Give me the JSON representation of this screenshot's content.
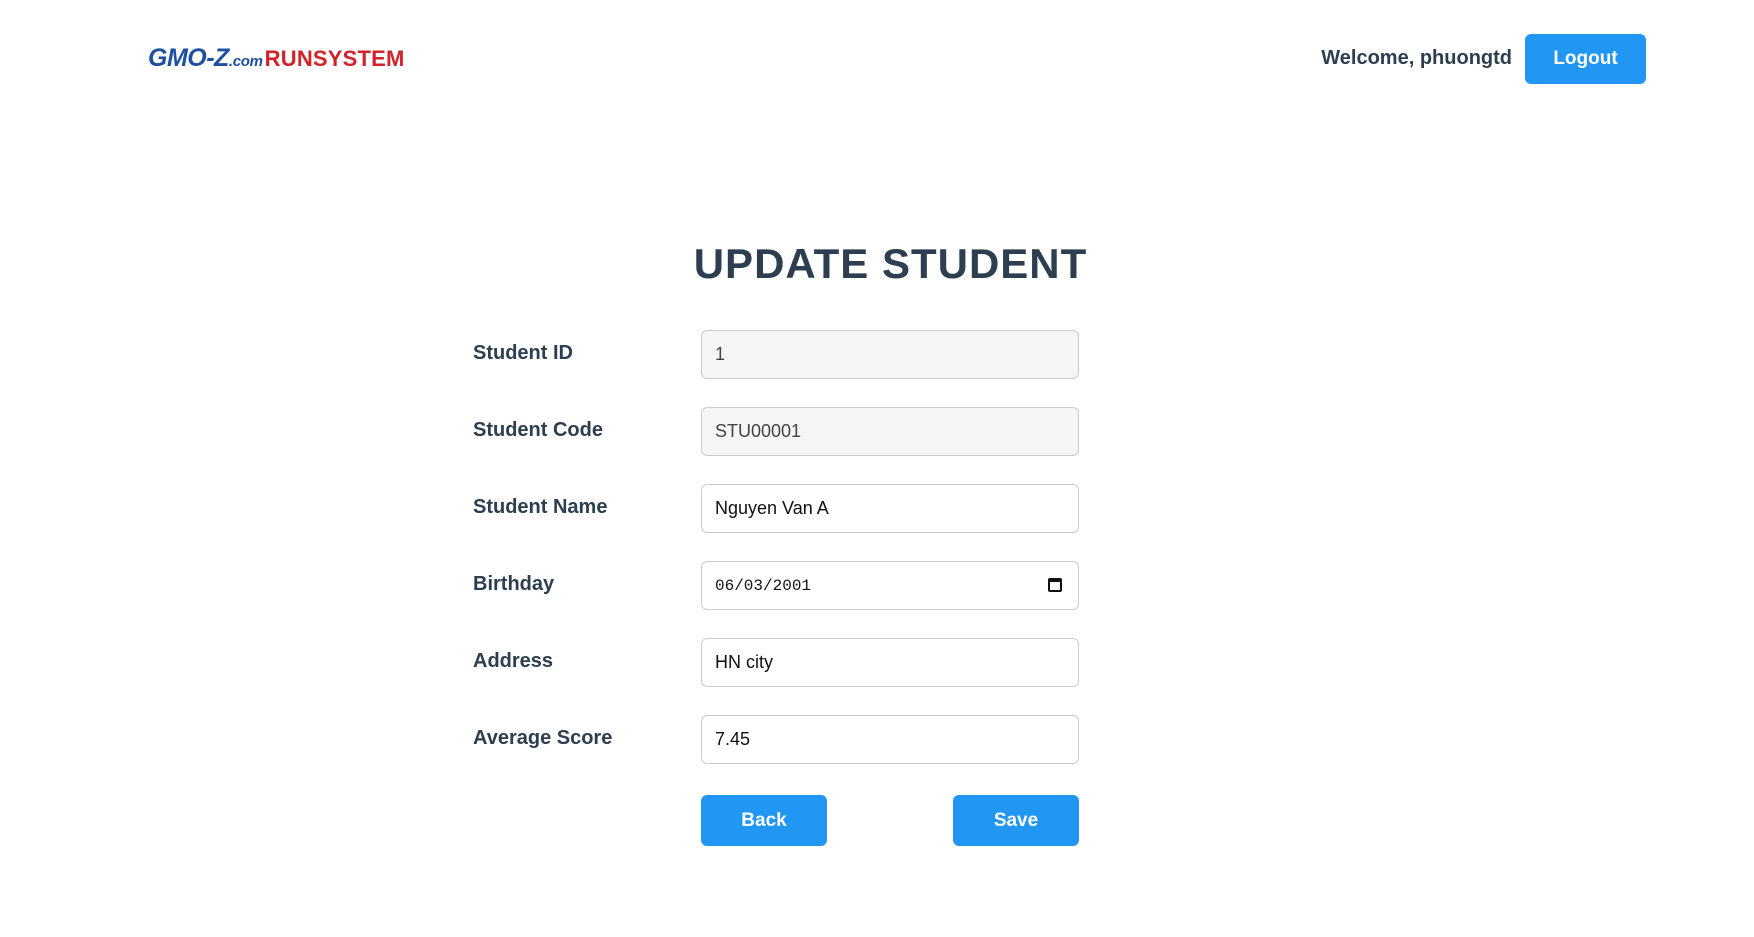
{
  "header": {
    "logo": {
      "part1": "GMO-Z",
      "part2": ".com",
      "part3": "RUNSYSTEM"
    },
    "welcome_text": "Welcome, phuongtd",
    "logout_label": "Logout"
  },
  "form": {
    "title": "UPDATE STUDENT",
    "fields": [
      {
        "label": "Student ID",
        "value": "1",
        "readonly": true
      },
      {
        "label": "Student Code",
        "value": "STU00001",
        "readonly": true
      },
      {
        "label": "Student Name",
        "value": "Nguyen Van A",
        "readonly": false
      },
      {
        "label": "Birthday",
        "value": "06/03/2001",
        "readonly": false
      },
      {
        "label": "Address",
        "value": "HN city",
        "readonly": false
      },
      {
        "label": "Average Score",
        "value": "7.45",
        "readonly": false
      }
    ],
    "back_label": "Back",
    "save_label": "Save"
  },
  "colors": {
    "primary": "#2196f3",
    "text": "#2c3e50",
    "logo_blue": "#1f4fa0",
    "logo_red": "#d1232a"
  },
  "icons": {
    "birthday_picker": "calendar-icon"
  }
}
